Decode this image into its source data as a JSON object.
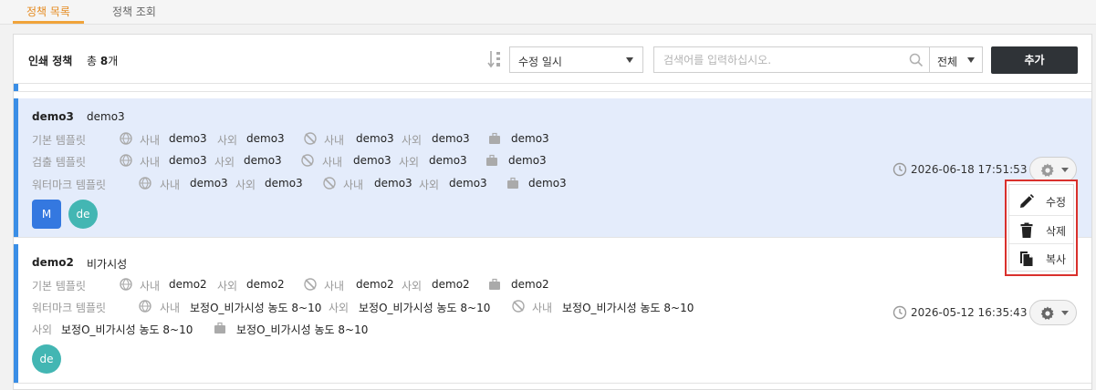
{
  "tabs": [
    {
      "label": "정책 목록",
      "active": true
    },
    {
      "label": "정책 조회",
      "active": false
    }
  ],
  "header": {
    "title": "인쇄 정책",
    "count_prefix": "총 ",
    "count_value": "8",
    "count_suffix": "개"
  },
  "sort": {
    "selected": "수정 일시"
  },
  "search": {
    "placeholder": "검색어를 입력하십시오.",
    "value": ""
  },
  "filter": {
    "selected": "전체"
  },
  "add_button": {
    "label": "추가"
  },
  "labels": {
    "internal": "사내",
    "external": "사외",
    "base_template": "기본 템플릿",
    "detect_template": "검출 템플릿",
    "watermark_template": "워터마크 템플릿"
  },
  "policies": [
    {
      "name": "demo3",
      "description": "demo3",
      "selected": true,
      "base": {
        "net_internal": "demo3",
        "net_external": "demo3",
        "offnet_internal": "demo3",
        "offnet_external": "demo3",
        "business": "demo3"
      },
      "detect": {
        "net_internal": "demo3",
        "net_external": "demo3",
        "offnet_internal": "demo3",
        "offnet_external": "demo3",
        "business": "demo3"
      },
      "watermark": {
        "net_internal": "demo3",
        "net_external": "demo3",
        "offnet_internal": "demo3",
        "offnet_external": "demo3",
        "business": "demo3"
      },
      "chips": [
        "M",
        "de"
      ],
      "modified": "2026-06-18 17:51:53"
    },
    {
      "name": "demo2",
      "description": "비가시성",
      "selected": false,
      "base": {
        "net_internal": "demo2",
        "net_external": "demo2",
        "offnet_internal": "demo2",
        "offnet_external": "demo2",
        "business": "demo2"
      },
      "watermark": {
        "net_internal": "보정O_비가시성 농도 8~10",
        "net_external": "보정O_비가시성 농도 8~10",
        "offnet_internal": "보정O_비가시성 농도 8~10",
        "offnet_external": "보정O_비가시성 농도 8~10",
        "business": "보정O_비가시성 농도 8~10"
      },
      "chips": [
        "de"
      ],
      "modified": "2026-05-12 16:35:43"
    }
  ],
  "context_menu": {
    "items": [
      {
        "label": "수정",
        "icon": "pencil-icon"
      },
      {
        "label": "삭제",
        "icon": "trash-icon"
      },
      {
        "label": "복사",
        "icon": "copy-icon"
      }
    ]
  },
  "colors": {
    "accent": "#3a8ee6",
    "active_tab": "#f0a33a",
    "selected_row": "#e4ecfb",
    "add_button": "#2f3337",
    "menu_highlight": "#d9302c",
    "chip_blue": "#3478e0",
    "chip_teal": "#43b6b3"
  }
}
